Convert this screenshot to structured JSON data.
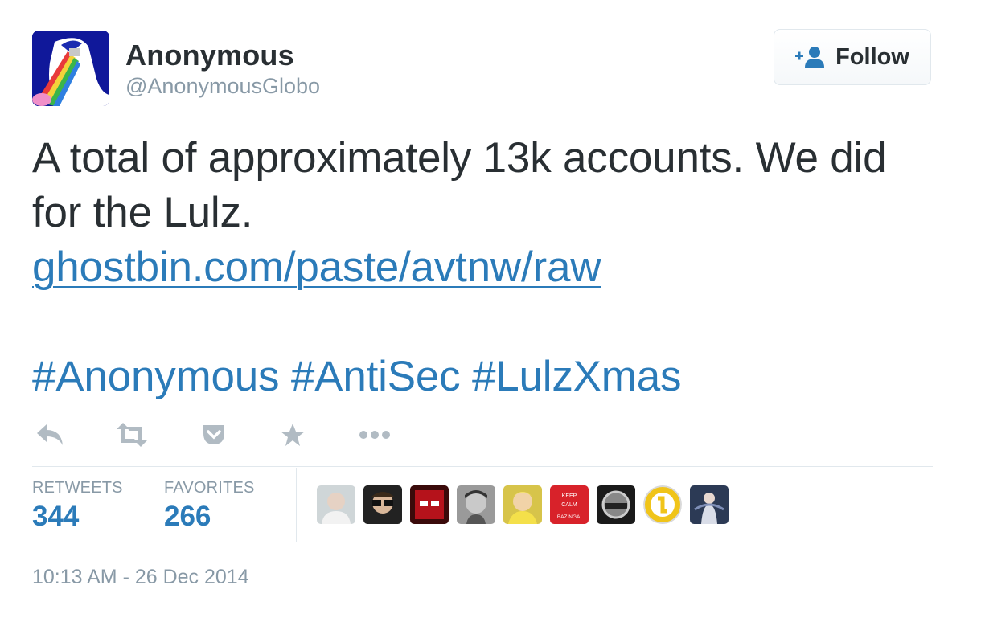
{
  "header": {
    "display_name": "Anonymous",
    "handle": "@AnonymousGlobo",
    "avatar_icon": "anonymous-rainbow-avatar",
    "follow_label": "Follow",
    "follow_icon": "add-user-icon"
  },
  "tweet": {
    "line1": "A total of approximately 13k accounts. We did for the Lulz.",
    "link": "ghostbin.com/paste/avtnw/raw",
    "hashtags": [
      "#Anonymous",
      "#AntiSec",
      "#LulzXmas"
    ]
  },
  "actions": [
    {
      "name": "reply-icon"
    },
    {
      "name": "retweet-icon"
    },
    {
      "name": "pocket-icon"
    },
    {
      "name": "favorite-star-icon"
    },
    {
      "name": "more-icon"
    }
  ],
  "stats": {
    "retweets_label": "RETWEETS",
    "retweets_value": "344",
    "favorites_label": "FAVORITES",
    "favorites_value": "266"
  },
  "favoriters": [
    {
      "avatar": "user-avatar-1"
    },
    {
      "avatar": "user-avatar-2"
    },
    {
      "avatar": "user-avatar-3"
    },
    {
      "avatar": "user-avatar-4"
    },
    {
      "avatar": "user-avatar-5"
    },
    {
      "avatar": "keep-calm-avatar",
      "lines": [
        "KEEP",
        "CALM",
        "BAZINGA!"
      ]
    },
    {
      "avatar": "user-avatar-7"
    },
    {
      "avatar": "user-avatar-8"
    },
    {
      "avatar": "user-avatar-9"
    }
  ],
  "timestamp": "10:13 AM - 26 Dec 2014",
  "colors": {
    "link": "#2b7bb9",
    "muted": "#8899a6",
    "text": "#292f33",
    "border": "#e1e8ed"
  }
}
